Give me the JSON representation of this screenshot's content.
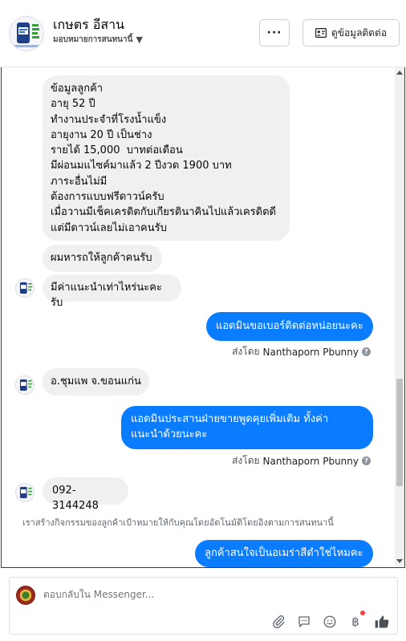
{
  "header": {
    "page_name": "เกษตร อีสาน",
    "page_subtitle": "มอบหมายการสนทนานี้",
    "more_label": "···",
    "contact_button_label": "ดูข้อมูลติดต่อ"
  },
  "messages": {
    "m1": "ข้อมูลลูกค้า\nอายุ 52 ปี\nทำงานประจำที่โรงน้ำแข็ง\nอายุงาน 20 ปี เป็นช่าง\nรายได้ 15,000  บาทต่อเดือน\nมีผ่อนมแไซค์มาแล้ว 2 ปีงวด 1900 บาท\nภาระอื่นไม่มี\nต้องการแบบฟรีดาวน์ครับ\nเมื่อวานมีเช็คเครดิตกับเกียรตินาคินไปแล้วเครดิตดี\nแต่มีดาวน์เลยไม่เอาคนรับ",
    "m2": "ผมหารถให้ลูกค้าคนรับ",
    "m3": "มีค่าแนะนำเท่าไหร่นะคะรับ",
    "m4": "แอดมินขอเบอร์ติดต่อหน่อยนะคะ",
    "m5": "อ.ชุมแพ จ.ขอนแก่น",
    "m6": "แอดมินประสานฝ่ายขายพูดคุยเพิ่มเติม ทั้งค่า\nแนะนำด้วยนะคะ",
    "m7": "092-3144248",
    "m8": "ลูกค้าสนใจเป็นอเมร่าสีดำใช่ไหมคะ"
  },
  "sent_by": {
    "prefix": "ส่งโดย",
    "name": "Nanthaporn Pbunny"
  },
  "notice": "เราสร้างกิจกรรมของลูกค้าเป้าหมายให้กับคุณโดยอัตโนมัติโดยอิงตามการสนทนานี้",
  "composer": {
    "placeholder": "ตอบกลับใน Messenger..."
  },
  "colors": {
    "outgoing_bubble": "#0a7cff",
    "incoming_bubble": "#f0f0f0",
    "like_icon": "#4b4f56",
    "notification_dot": "#fa3e3e"
  },
  "icons": [
    "page-logo-icon",
    "contact-card-icon",
    "attachment-icon",
    "chat-bubble-icon",
    "emoji-icon",
    "baht-icon",
    "like-icon",
    "help-icon"
  ]
}
